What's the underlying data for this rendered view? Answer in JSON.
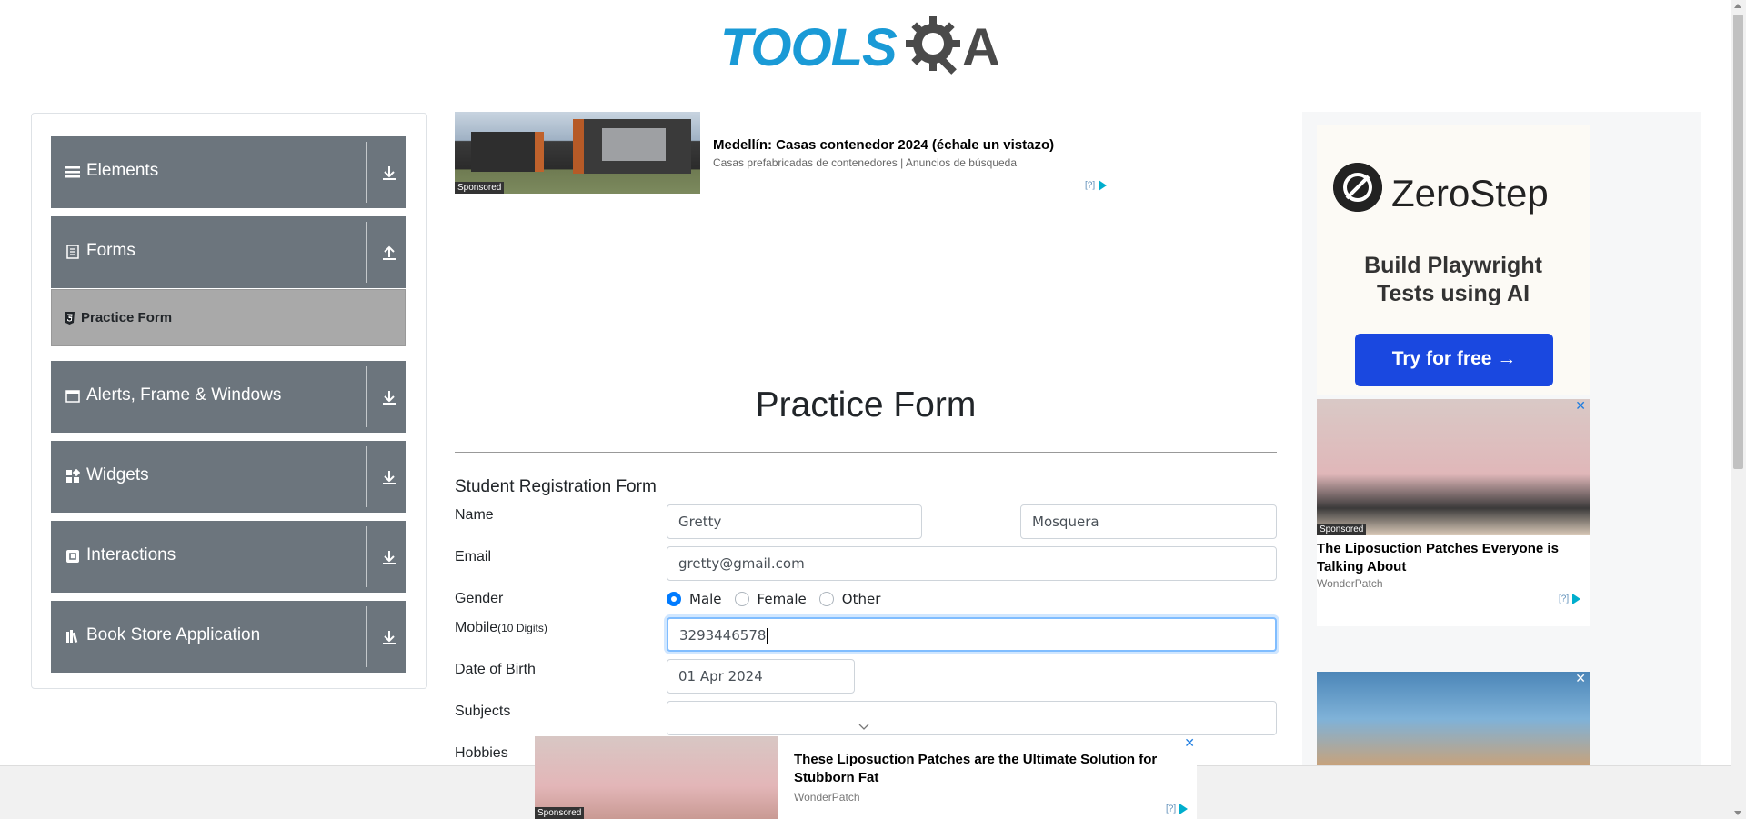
{
  "logo": {
    "text_left": "TOOLS",
    "text_right": "A"
  },
  "sidebar": {
    "groups": [
      {
        "label": "Elements",
        "icon": "hamburger-icon",
        "arrow": "down"
      },
      {
        "label": "Forms",
        "icon": "document-icon",
        "arrow": "up"
      },
      {
        "label": "Alerts, Frame & Windows",
        "icon": "window-icon",
        "arrow": "down"
      },
      {
        "label": "Widgets",
        "icon": "widgets-icon",
        "arrow": "down"
      },
      {
        "label": "Interactions",
        "icon": "interactions-icon",
        "arrow": "down"
      },
      {
        "label": "Book Store Application",
        "icon": "books-icon",
        "arrow": "down"
      }
    ],
    "active_item": "Practice Form"
  },
  "ad_top": {
    "title": "Medellín: Casas contenedor 2024 (échale un vistazo)",
    "subtitle": "Casas prefabricadas de contenedores | Anuncios de búsqueda",
    "sponsored": "Sponsored",
    "adchoice": "[?]"
  },
  "form": {
    "page_title": "Practice Form",
    "heading": "Student Registration Form",
    "labels": {
      "name": "Name",
      "email": "Email",
      "gender": "Gender",
      "mobile": "Mobile",
      "mobile_hint": "(10 Digits)",
      "dob": "Date of Birth",
      "subjects": "Subjects",
      "hobbies": "Hobbies"
    },
    "first_name": "Gretty",
    "last_name": "Mosquera",
    "email": "gretty@gmail.com",
    "gender_options": [
      "Male",
      "Female",
      "Other"
    ],
    "gender_selected": "Male",
    "mobile": "3293446578",
    "dob": "01 Apr 2024",
    "subjects": ""
  },
  "ad_right": {
    "brand": "ZeroStep",
    "tagline_1": "Build Playwright",
    "tagline_2": "Tests using AI",
    "button": "Try for free →",
    "card_title": "The Liposuction Patches Everyone is Talking About",
    "card_brand": "WonderPatch",
    "sponsored": "Sponsored",
    "adchoice": "[?]",
    "close": "✕"
  },
  "ad_bottom": {
    "title": "These Liposuction Patches are the Ultimate Solution for Stubborn Fat",
    "brand": "WonderPatch",
    "sponsored": "Sponsored",
    "adchoice": "[?]",
    "close": "✕"
  },
  "colors": {
    "accent": "#007bff",
    "sidebar_group": "#6c757d",
    "sidebar_active": "#a9a9a9",
    "logo_blue": "#1a9ad6"
  }
}
